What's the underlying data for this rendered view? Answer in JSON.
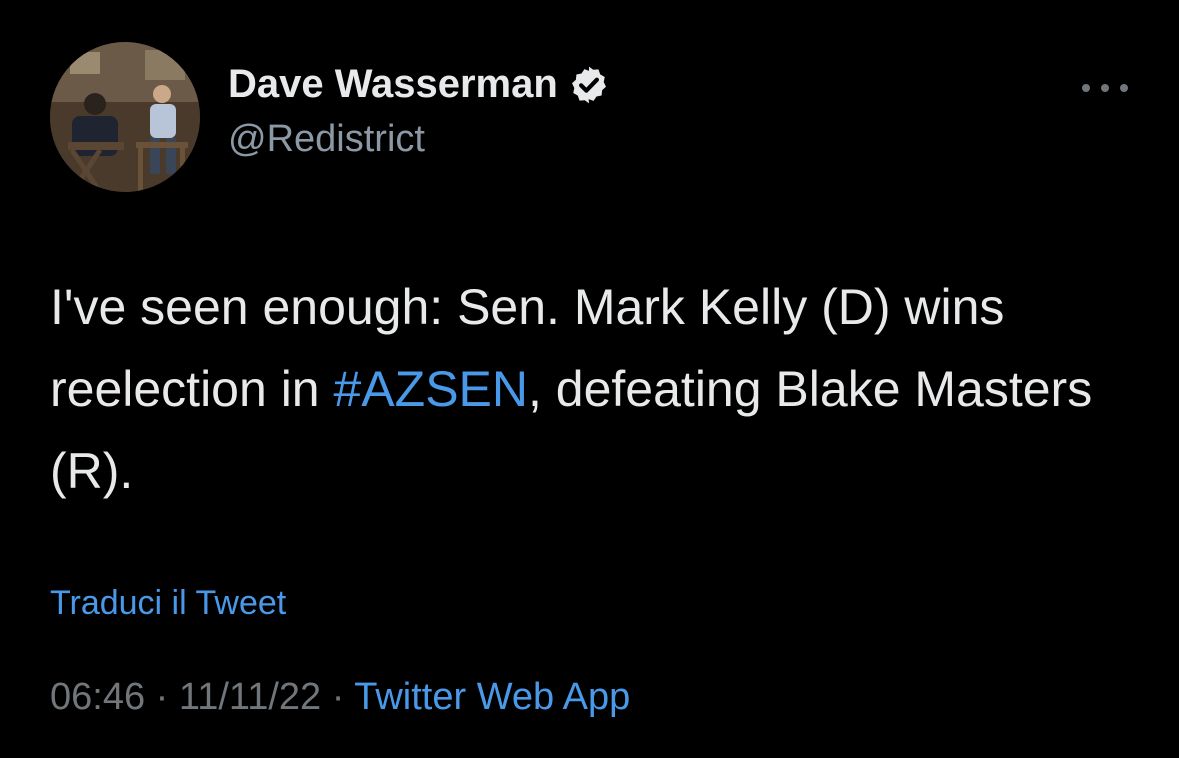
{
  "author": {
    "display_name": "Dave Wasserman",
    "handle": "@Redistrict",
    "verified": true
  },
  "tweet": {
    "text_before": "I've seen enough: Sen. Mark Kelly (D) wins reelection in ",
    "hashtag": "#AZSEN",
    "text_after": ", defeating Blake Masters (R).",
    "translate_label": "Traduci il Tweet"
  },
  "meta": {
    "time": "06:46",
    "separator": " · ",
    "date": "11/11/22",
    "source": "Twitter Web App"
  },
  "icons": {
    "more": "more-horizontal-icon",
    "verified": "verified-badge-icon"
  },
  "colors": {
    "background": "#000000",
    "text": "#e7e9ea",
    "secondary": "#71767b",
    "link": "#4a99e9"
  }
}
